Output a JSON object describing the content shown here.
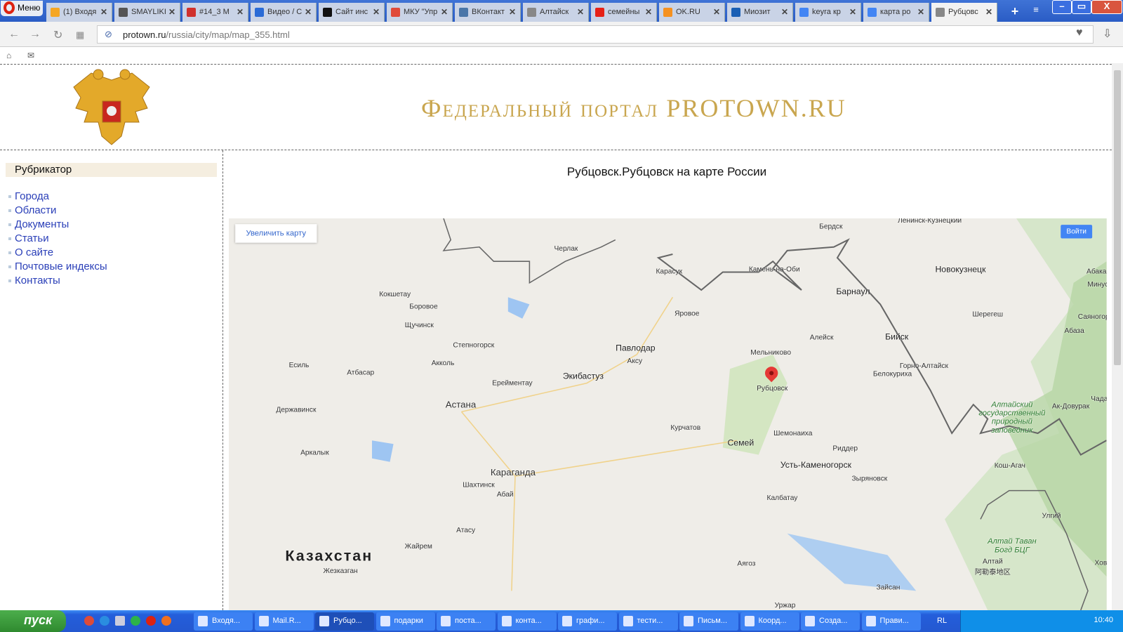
{
  "browser": {
    "menu_label": "Меню",
    "tabs": [
      {
        "title": "(1) Входя",
        "icon": "mailru-icon",
        "color": "#f5a623"
      },
      {
        "title": "SMAYLIKI",
        "icon": "smiley-icon",
        "color": "#555555"
      },
      {
        "title": "#14_3 М",
        "icon": "shield-icon",
        "color": "#d0312d"
      },
      {
        "title": "Видео / С",
        "icon": "person-icon",
        "color": "#2a6bd6"
      },
      {
        "title": "Сайт инс",
        "icon": "checkbox-icon",
        "color": "#111111"
      },
      {
        "title": "МКУ \"Упр",
        "icon": "doc-red-icon",
        "color": "#e04a3a"
      },
      {
        "title": "ВКонтакт",
        "icon": "vk-icon",
        "color": "#4a76a8"
      },
      {
        "title": "Алтайск",
        "icon": "page-icon",
        "color": "#888888"
      },
      {
        "title": "семейны",
        "icon": "youtube-icon",
        "color": "#e62117"
      },
      {
        "title": "OK.RU",
        "icon": "ok-icon",
        "color": "#f59120"
      },
      {
        "title": "Миозит",
        "icon": "h-icon",
        "color": "#1a5fb4"
      },
      {
        "title": "keyra кр",
        "icon": "google-icon",
        "color": "#4285f4"
      },
      {
        "title": "карта ро",
        "icon": "google-icon",
        "color": "#4285f4"
      },
      {
        "title": "Рубцовс",
        "icon": "page-icon",
        "color": "#888888",
        "active": true
      }
    ],
    "url_host": "protown.ru",
    "url_path": "/russia/city/map/map_355.html"
  },
  "site": {
    "title": "Федеральный портал PROTOWN.RU",
    "rubricator": "Рубрикатор",
    "nav": [
      "Города",
      "Области",
      "Документы",
      "Статьи",
      "О сайте",
      "Почтовые индексы",
      "Контакты"
    ],
    "heading": "Рубцовск.Рубцовск на карте России"
  },
  "map": {
    "zoom_button": "Увеличить карту",
    "login_button": "Войти",
    "marker": "Рубцовск",
    "labels": {
      "berdsk": "Бердск",
      "leninsk": "Ленинск-Кузнецкий",
      "cherlak": "Черлак",
      "karasuk": "Карасук",
      "kamen": "Камень-на-Оби",
      "novokuznetsk": "Новокузнецк",
      "abakan": "Абака",
      "kokshetau": "Кокшетау",
      "barnaul": "Барнаул",
      "borovoe": "Боровое",
      "yarovoe": "Яровое",
      "sheregesh": "Шерегеш",
      "minus": "Минус",
      "shchuchinsk": "Щучинск",
      "aleysk": "Алейск",
      "biysk": "Бийск",
      "abaza": "Абаза",
      "sayanogorsk": "Саяногор",
      "stepnogorsk": "Степногорск",
      "pavlodar": "Павлодар",
      "aksu": "Аксу",
      "melnikovo": "Мельниково",
      "esil": "Есиль",
      "akkol": "Акколь",
      "atbasar": "Атбасар",
      "ekibastuz": "Экибастуз",
      "gorno": "Горно-Алтайск",
      "belokurikha": "Белокуриха",
      "ereymentau": "Ерейментау",
      "rubtsovsk": "Рубцовск",
      "astana": "Астана",
      "derzhavinsk": "Державинск",
      "zapovednik": "Алтайский\nгосударственный\nприродный\nзаповедник",
      "akdovurak": "Ак-Довурак",
      "chada": "Чада",
      "kurchatov": "Курчатов",
      "shemonaikha": "Шемонаиха",
      "semey": "Семей",
      "ridder": "Риддер",
      "arkalyk": "Аркалык",
      "ustkam": "Усть-Каменогорск",
      "koshagach": "Кош-Агач",
      "zyryanovsk": "Зыряновск",
      "karaganda": "Караганда",
      "shakhtinsk": "Шахтинск",
      "abay": "Абай",
      "kalbatau": "Калбатау",
      "ulgiy": "Улгий",
      "atasu": "Атасу",
      "tavan": "Алтай Таван\nБогд БЦГ",
      "zhairem": "Жайрем",
      "altay": "Алтай",
      "altay_cn": "阿勒泰地区",
      "khov": "Хов",
      "kazakhstan": "Казахстан",
      "zhezkazgan": "Жезказган",
      "ayagoz": "Аягоз",
      "zaysan": "Зайсан",
      "urzhar": "Уржар"
    }
  },
  "taskbar": {
    "start": "пуск",
    "tasks": [
      "Входя...",
      "Mail.R...",
      "Рубцо...",
      "подарки",
      "поста...",
      "конта...",
      "графи...",
      "тести...",
      "Письм...",
      "Коорд...",
      "Созда...",
      "Прави..."
    ],
    "lang": "RL",
    "clock": "10:40"
  }
}
